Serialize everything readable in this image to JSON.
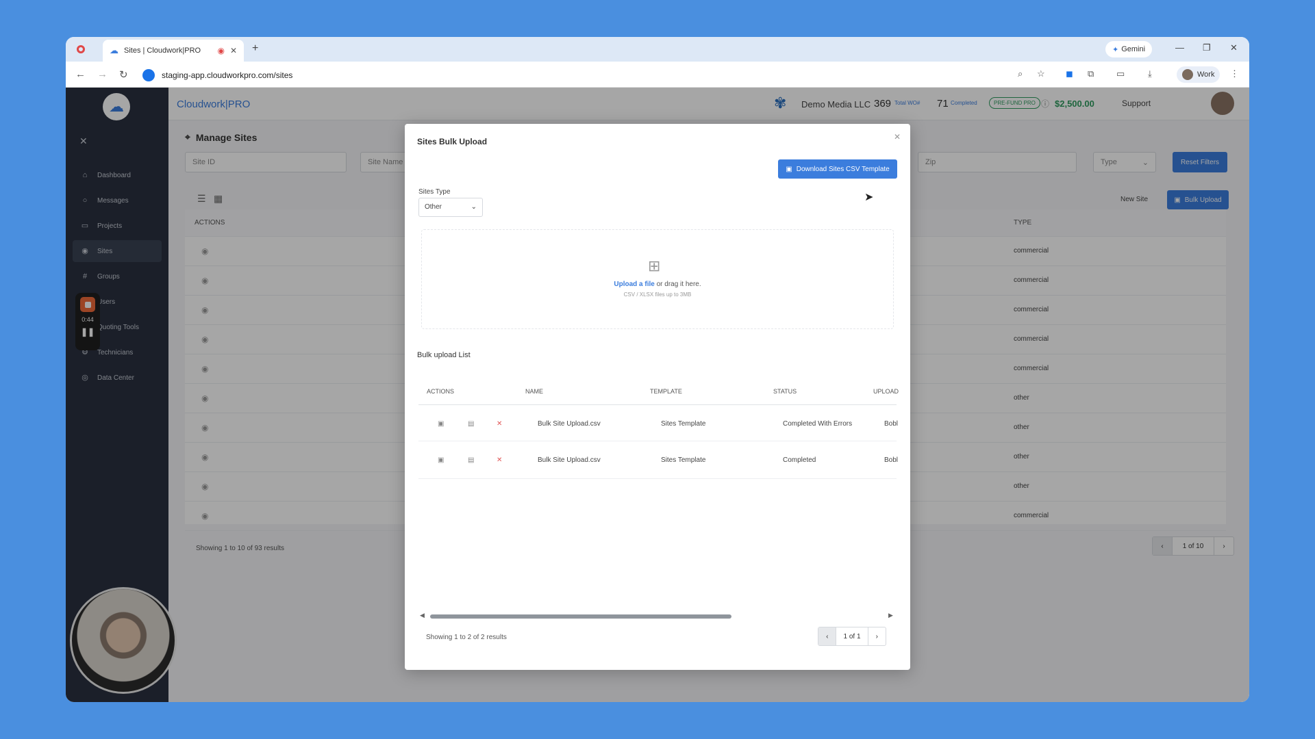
{
  "browser": {
    "tab_title": "Sites | Cloudwork|PRO",
    "url": "staging-app.cloudworkpro.com/sites",
    "gemini": "Gemini",
    "profile": "Work"
  },
  "header": {
    "brand": "Cloudwork|PRO",
    "company": "Demo Media LLC",
    "total_wo_count": "369",
    "total_wo_label": "Total WO#",
    "completed_count": "71",
    "completed_label": "Completed",
    "badge": "PRE-FUND PRO",
    "balance": "$2,500.00",
    "support": "Support"
  },
  "sidebar": {
    "items": [
      {
        "label": "Dashboard",
        "icon": "home-icon"
      },
      {
        "label": "Messages",
        "icon": "chat-icon"
      },
      {
        "label": "Projects",
        "icon": "folder-icon"
      },
      {
        "label": "Sites",
        "icon": "pin-icon"
      },
      {
        "label": "Groups",
        "icon": "hash-icon"
      },
      {
        "label": "Users",
        "icon": "user-icon"
      },
      {
        "label": "Quoting Tools",
        "icon": "tool-icon"
      },
      {
        "label": "Technicians",
        "icon": "tech-icon"
      },
      {
        "label": "Data Center",
        "icon": "db-icon"
      }
    ],
    "recording_time": "0:44"
  },
  "page": {
    "title": "Manage Sites",
    "site_id_placeholder": "Site ID",
    "site_name_placeholder": "Site Name",
    "zip_placeholder": "Zip",
    "type_placeholder": "Type",
    "reset_filters": "Reset Filters",
    "new_site": "New Site",
    "bulk_upload": "Bulk Upload",
    "col_actions": "ACTIONS",
    "col_type": "TYPE",
    "types": [
      "commercial",
      "commercial",
      "commercial",
      "commercial",
      "commercial",
      "other",
      "other",
      "other",
      "other",
      "commercial"
    ],
    "showing": "Showing 1 to 10 of 93 results",
    "page_indicator": "1 of 10"
  },
  "modal": {
    "title": "Sites Bulk Upload",
    "download_label": "Download Sites CSV Template",
    "sites_type_label": "Sites Type",
    "sites_type_value": "Other",
    "upload_link": "Upload a file",
    "upload_text": "or drag it here.",
    "upload_hint": "CSV / XLSX files up to 3MB",
    "list_title": "Bulk upload List",
    "columns": [
      "ACTIONS",
      "NAME",
      "TEMPLATE",
      "STATUS",
      "UPLOAD"
    ],
    "rows": [
      {
        "name": "Bulk Site Upload.csv",
        "template": "Sites Template",
        "status": "Completed With Errors",
        "upload": "Bobl"
      },
      {
        "name": "Bulk Site Upload.csv",
        "template": "Sites Template",
        "status": "Completed",
        "upload": "Bobl"
      }
    ],
    "showing": "Showing 1 to 2 of 2 results",
    "page_indicator": "1 of 1"
  },
  "colors": {
    "accent": "#3b7ddd",
    "sidebar": "#2a3140",
    "close_red": "#e05555",
    "balance_green": "#2e9b5e"
  }
}
